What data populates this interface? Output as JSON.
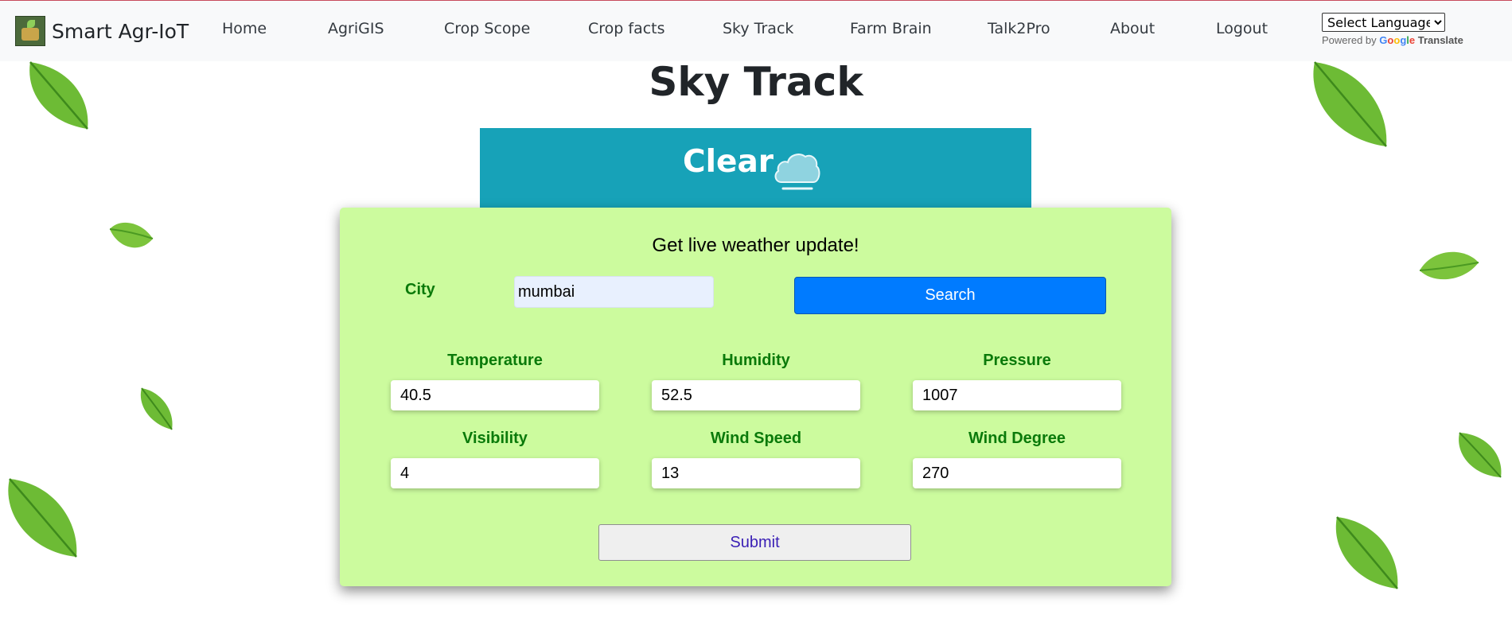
{
  "navbar": {
    "brand": "Smart Agr-IoT",
    "items": [
      {
        "label": "Home"
      },
      {
        "label": "AgriGIS"
      },
      {
        "label": "Crop Scope"
      },
      {
        "label": "Crop facts"
      },
      {
        "label": "Sky Track"
      },
      {
        "label": "Farm Brain"
      },
      {
        "label": "Talk2Pro"
      },
      {
        "label": "About"
      },
      {
        "label": "Logout"
      }
    ],
    "translate": {
      "select_label": "Select Language",
      "powered_by": "Powered by",
      "google": "Google",
      "translate": "Translate"
    }
  },
  "page": {
    "title": "Sky Track"
  },
  "weather_status": {
    "condition": "Clear",
    "icon": "cloud-icon"
  },
  "form": {
    "heading": "Get live weather update!",
    "city_label": "City",
    "city_value": "mumbai",
    "search_label": "Search",
    "metrics": [
      {
        "label": "Temperature",
        "value": "40.5"
      },
      {
        "label": "Humidity",
        "value": "52.5"
      },
      {
        "label": "Pressure",
        "value": "1007"
      },
      {
        "label": "Visibility",
        "value": "4"
      },
      {
        "label": "Wind Speed",
        "value": "13"
      },
      {
        "label": "Wind Degree",
        "value": "270"
      }
    ],
    "submit_label": "Submit"
  },
  "colors": {
    "banner": "#17a2b8",
    "card": "#ccfb9e",
    "label_green": "#0a7a0a",
    "search_blue": "#007bff"
  }
}
